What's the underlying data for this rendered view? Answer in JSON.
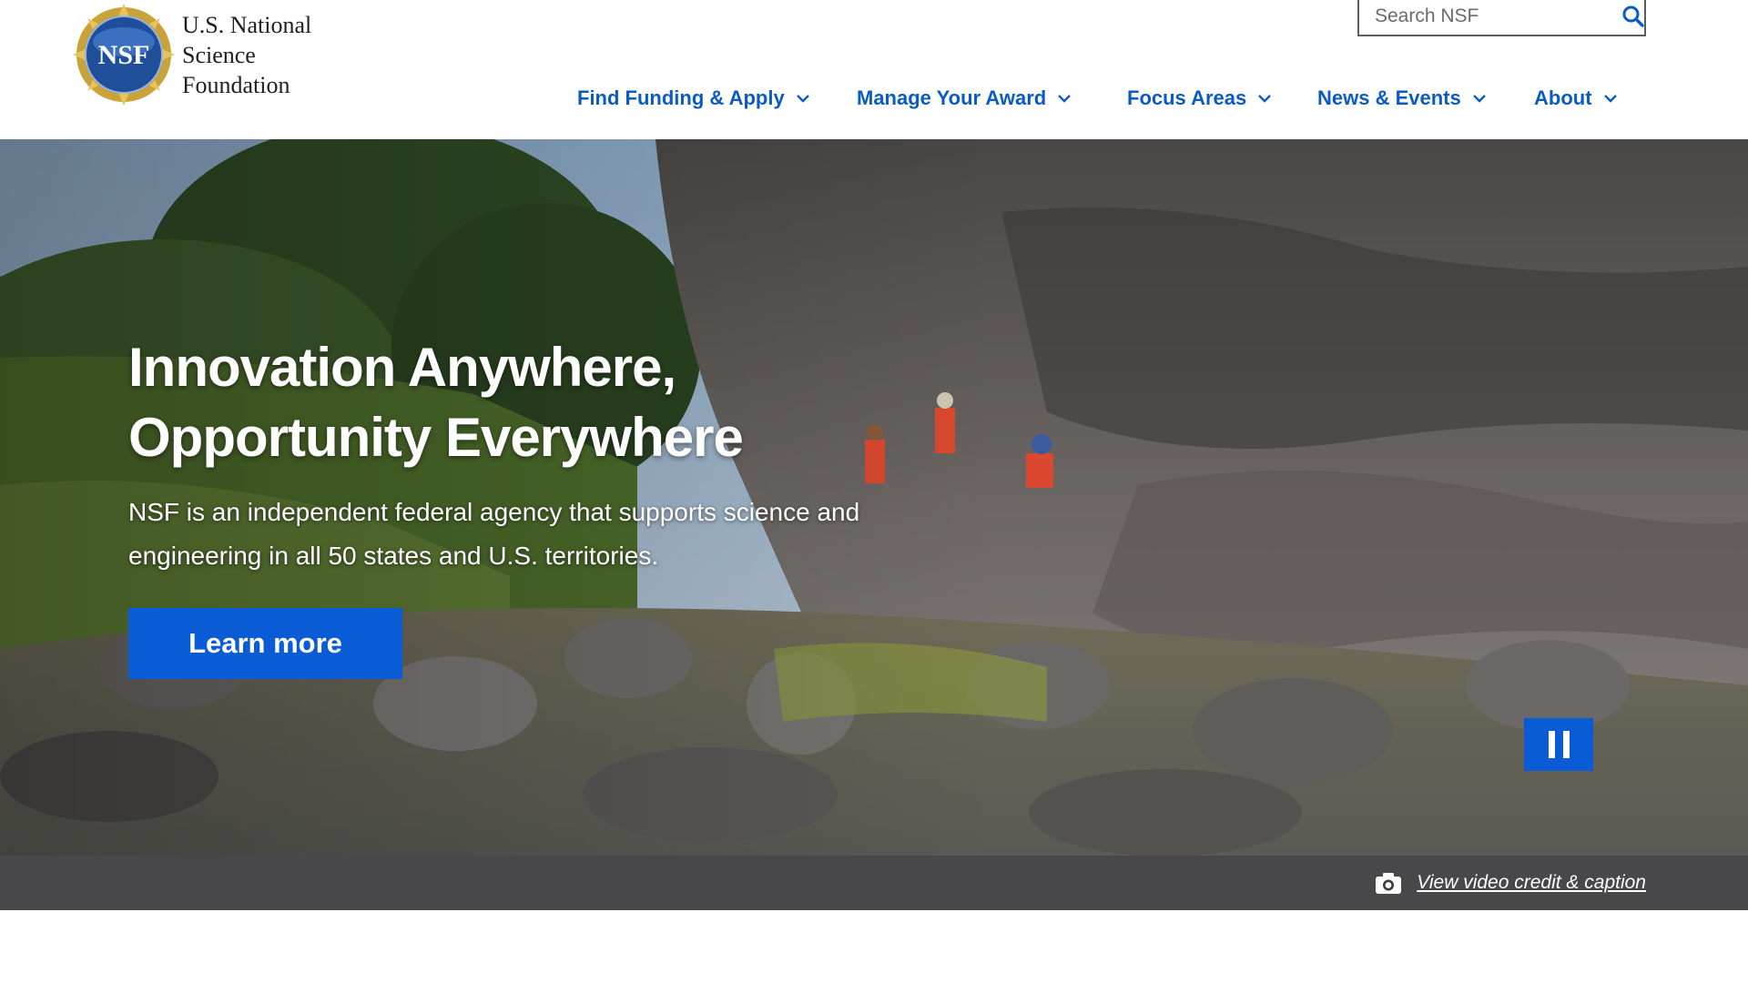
{
  "header": {
    "logo": {
      "seal_text": "NSF",
      "lines": [
        "U.S. National",
        "Science",
        "Foundation"
      ]
    },
    "search": {
      "placeholder": "Search NSF",
      "icon": "search-icon"
    },
    "nav": [
      {
        "label": "Find Funding & Apply",
        "icon": "chevron-down-icon"
      },
      {
        "label": "Manage Your Award",
        "icon": "chevron-down-icon"
      },
      {
        "label": "Focus Areas",
        "icon": "chevron-down-icon"
      },
      {
        "label": "News & Events",
        "icon": "chevron-down-icon"
      },
      {
        "label": "About",
        "icon": "chevron-down-icon"
      }
    ]
  },
  "hero": {
    "title_line1": "Innovation Anywhere,",
    "title_line2": "Opportunity Everywhere",
    "description": "NSF is an independent federal agency that supports science and engineering in all 50 states and U.S. territories.",
    "cta_label": "Learn more",
    "pause_icon": "pause-icon",
    "credit_icon": "camera-icon",
    "credit_label": "View video credit & caption"
  },
  "colors": {
    "nav_link": "#0b5bc4",
    "primary_button": "#0a5bd6",
    "caption_bar": "#3b3c3e"
  }
}
